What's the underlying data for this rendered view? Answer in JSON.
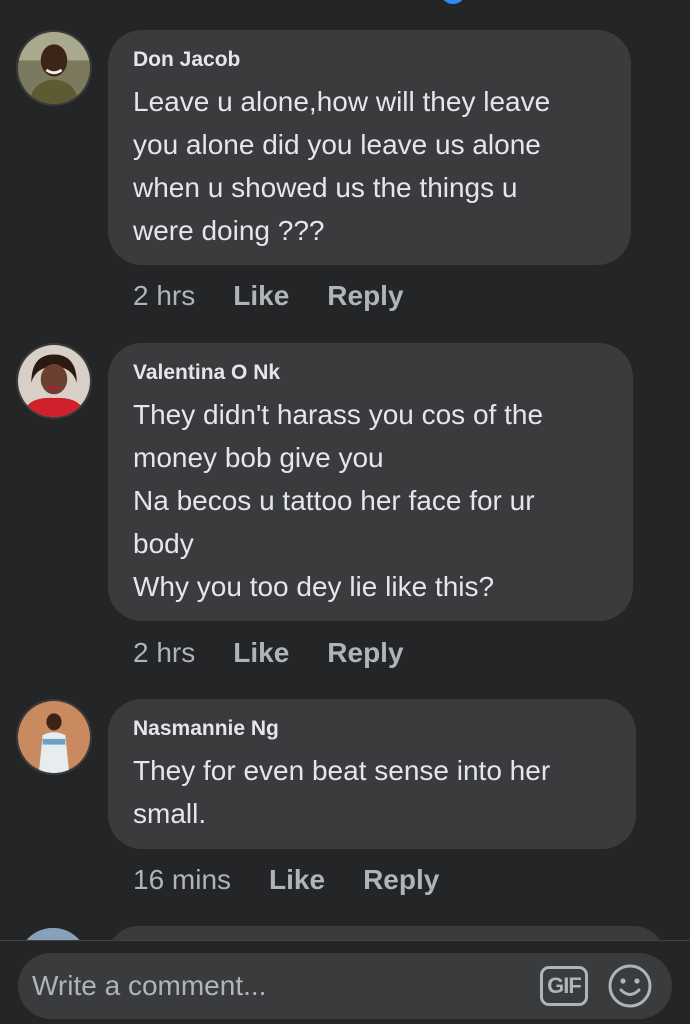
{
  "comments": [
    {
      "author": "Don Jacob",
      "text": "Leave u alone,how will they leave\nyou alone did you leave us alone\nwhen u showed us the things u\nwere doing ???",
      "time": "2 hrs",
      "like_label": "Like",
      "reply_label": "Reply",
      "avatar_icon": "person-avatar-icon"
    },
    {
      "author": "Valentina O Nk",
      "text": "They didn't harass you cos of the\nmoney bob give you\nNa becos u tattoo her face for ur\nbody\nWhy you too dey lie like this?",
      "time": "2 hrs",
      "like_label": "Like",
      "reply_label": "Reply",
      "avatar_icon": "person-avatar-icon"
    },
    {
      "author": "Nasmannie Ng",
      "text": "They for even beat sense into her\nsmall.",
      "time": "16 mins",
      "like_label": "Like",
      "reply_label": "Reply",
      "avatar_icon": "person-avatar-icon"
    }
  ],
  "composer": {
    "placeholder": "Write a comment...",
    "gif_label": "GIF",
    "emoji_icon": "smiley-face-icon"
  },
  "colors": {
    "background": "#242526",
    "bubble": "#3a3b3c",
    "text": "#e4e6eb",
    "secondary_text": "#b0b3b8",
    "accent": "#2d88ff"
  }
}
